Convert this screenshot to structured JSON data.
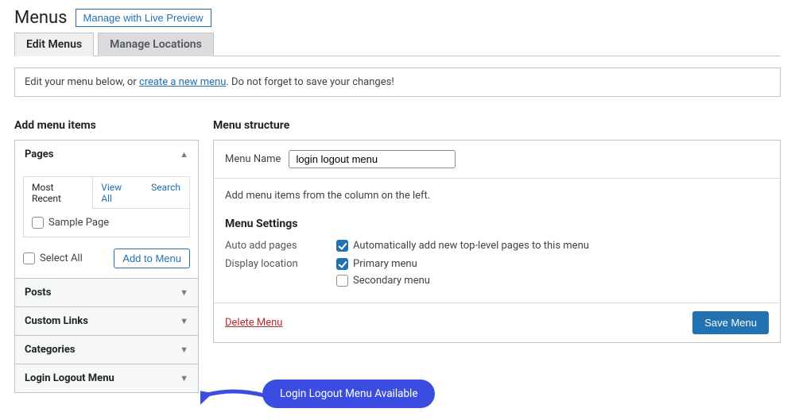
{
  "heading": {
    "title": "Menus",
    "preview_btn": "Manage with Live Preview"
  },
  "tabs": {
    "edit": "Edit Menus",
    "locations": "Manage Locations"
  },
  "notice": {
    "pre": "Edit your menu below, or ",
    "link": "create a new menu",
    "post": ". Do not forget to save your changes!"
  },
  "left": {
    "heading": "Add menu items",
    "pages": {
      "title": "Pages",
      "tabs": {
        "recent": "Most Recent",
        "view_all": "View All",
        "search": "Search"
      },
      "items": {
        "sample_page": "Sample Page"
      },
      "select_all": "Select All",
      "add_btn": "Add to Menu"
    },
    "posts": "Posts",
    "custom_links": "Custom Links",
    "categories": "Categories",
    "login_logout": "Login Logout Menu"
  },
  "right": {
    "heading": "Menu structure",
    "menu_name_label": "Menu Name",
    "menu_name_value": "login logout menu",
    "info": "Add menu items from the column on the left.",
    "settings_heading": "Menu Settings",
    "auto_add_label": "Auto add pages",
    "auto_add_option": "Automatically add new top-level pages to this menu",
    "display_loc_label": "Display location",
    "loc_primary": "Primary menu",
    "loc_secondary": "Secondary menu",
    "delete": "Delete Menu",
    "save": "Save Menu"
  },
  "callout": "Login Logout Menu Available"
}
